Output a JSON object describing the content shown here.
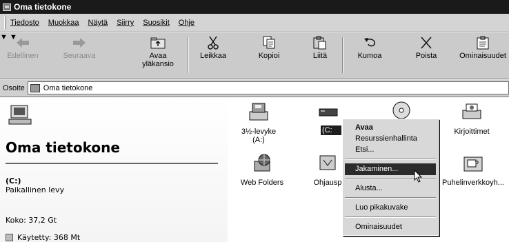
{
  "window": {
    "title": "Oma tietokone"
  },
  "menu": {
    "items": [
      "Tiedosto",
      "Muokkaa",
      "Näytä",
      "Siirry",
      "Suosikit",
      "Ohje"
    ]
  },
  "toolbar": {
    "back": "Edellinen",
    "forward": "Seuraava",
    "up_line1": "Avaa",
    "up_line2": "yläkansio",
    "cut": "Leikkaa",
    "copy": "Kopioi",
    "paste": "Liitä",
    "undo": "Kumoa",
    "delete": "Poista",
    "properties": "Ominaisuudet"
  },
  "address": {
    "label": "Osoite",
    "value": "Oma tietokone"
  },
  "left_pane": {
    "title": "Oma tietokone",
    "drive_name": "(C:)",
    "drive_desc": "Paikallinen levy",
    "size": "Koko: 37,2 Gt",
    "used": "Käytetty: 368 Mt"
  },
  "icons": {
    "floppy": "3½-levyke (A:)",
    "c_drive": "(C:",
    "web_folders": "Web Folders",
    "control_panel": "Ohjausp",
    "printers": "Kirjoittimet",
    "dialup": "Puhelinverkkoyh..."
  },
  "context_menu": {
    "items": [
      "Avaa",
      "Resurssienhallinta",
      "Etsi...",
      "Jakaminen...",
      "Alusta...",
      "Luo pikakuvake",
      "Ominaisuudet"
    ],
    "selected": "Jakaminen..."
  },
  "colors": {
    "titlebar": "#1a1a1a",
    "menu_bg": "#d8d8d8",
    "selection": "#2b2b2b"
  }
}
